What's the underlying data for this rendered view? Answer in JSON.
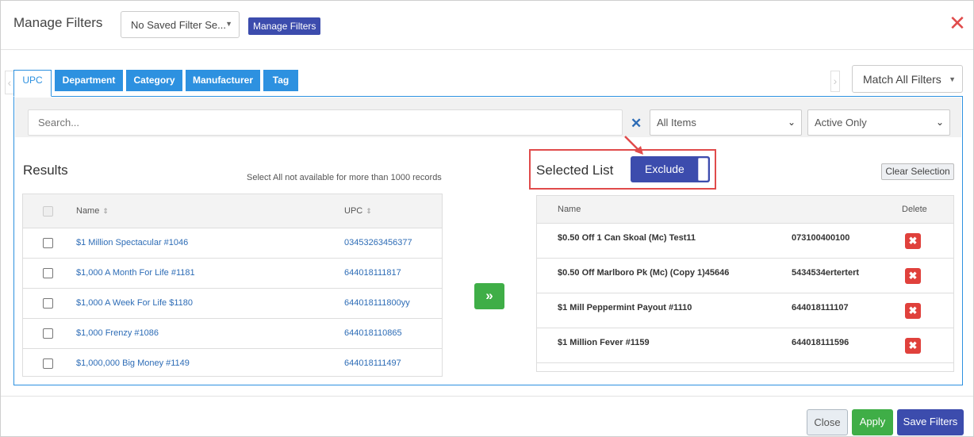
{
  "header": {
    "title": "Manage Filters",
    "saved_filter_value": "No Saved Filter Se...",
    "manage_filters_label": "Manage Filters",
    "close_glyph": "✕"
  },
  "tabs": [
    {
      "label": "UPC",
      "active": true
    },
    {
      "label": "Department",
      "active": false
    },
    {
      "label": "Category",
      "active": false
    },
    {
      "label": "Manufacturer",
      "active": false
    },
    {
      "label": "Tag",
      "active": false
    }
  ],
  "match_select_value": "Match All Filters",
  "filterbar": {
    "search_placeholder": "Search...",
    "items_value": "All Items",
    "status_value": "Active Only"
  },
  "results": {
    "title": "Results",
    "note": "Select All not available for more than 1000 records",
    "columns": {
      "name": "Name",
      "upc": "UPC"
    },
    "rows": [
      {
        "name": "$1 Million Spectacular #1046",
        "upc": "03453263456377"
      },
      {
        "name": "$1,000 A Month For Life #1181",
        "upc": "644018111817"
      },
      {
        "name": "$1,000 A Week For Life $1180",
        "upc": "644018111800yy"
      },
      {
        "name": "$1,000 Frenzy #1086",
        "upc": "644018110865"
      },
      {
        "name": "$1,000,000 Big Money #1149",
        "upc": "644018111497"
      }
    ]
  },
  "move_button_glyph": "»",
  "selected": {
    "title": "Selected List",
    "toggle_label": "Exclude",
    "clear_label": "Clear Selection",
    "columns": {
      "name": "Name",
      "delete": "Delete"
    },
    "rows": [
      {
        "name": "$0.50 Off 1 Can Skoal (Mc) Test11",
        "upc": "073100400100"
      },
      {
        "name": "$0.50 Off Marlboro Pk (Mc) (Copy 1)45646",
        "upc": "5434534ertertert"
      },
      {
        "name": "$1 Mill Peppermint Payout #1110",
        "upc": "644018111107"
      },
      {
        "name": "$1 Million Fever #1159",
        "upc": "644018111596"
      }
    ]
  },
  "footer": {
    "close_label": "Close",
    "apply_label": "Apply",
    "save_label": "Save Filters"
  },
  "colors": {
    "tab_blue": "#2d91e0",
    "brand_indigo": "#3c4cad",
    "apply_green": "#3fae47",
    "delete_red": "#e0413c",
    "highlight_red": "#e04b4b"
  }
}
